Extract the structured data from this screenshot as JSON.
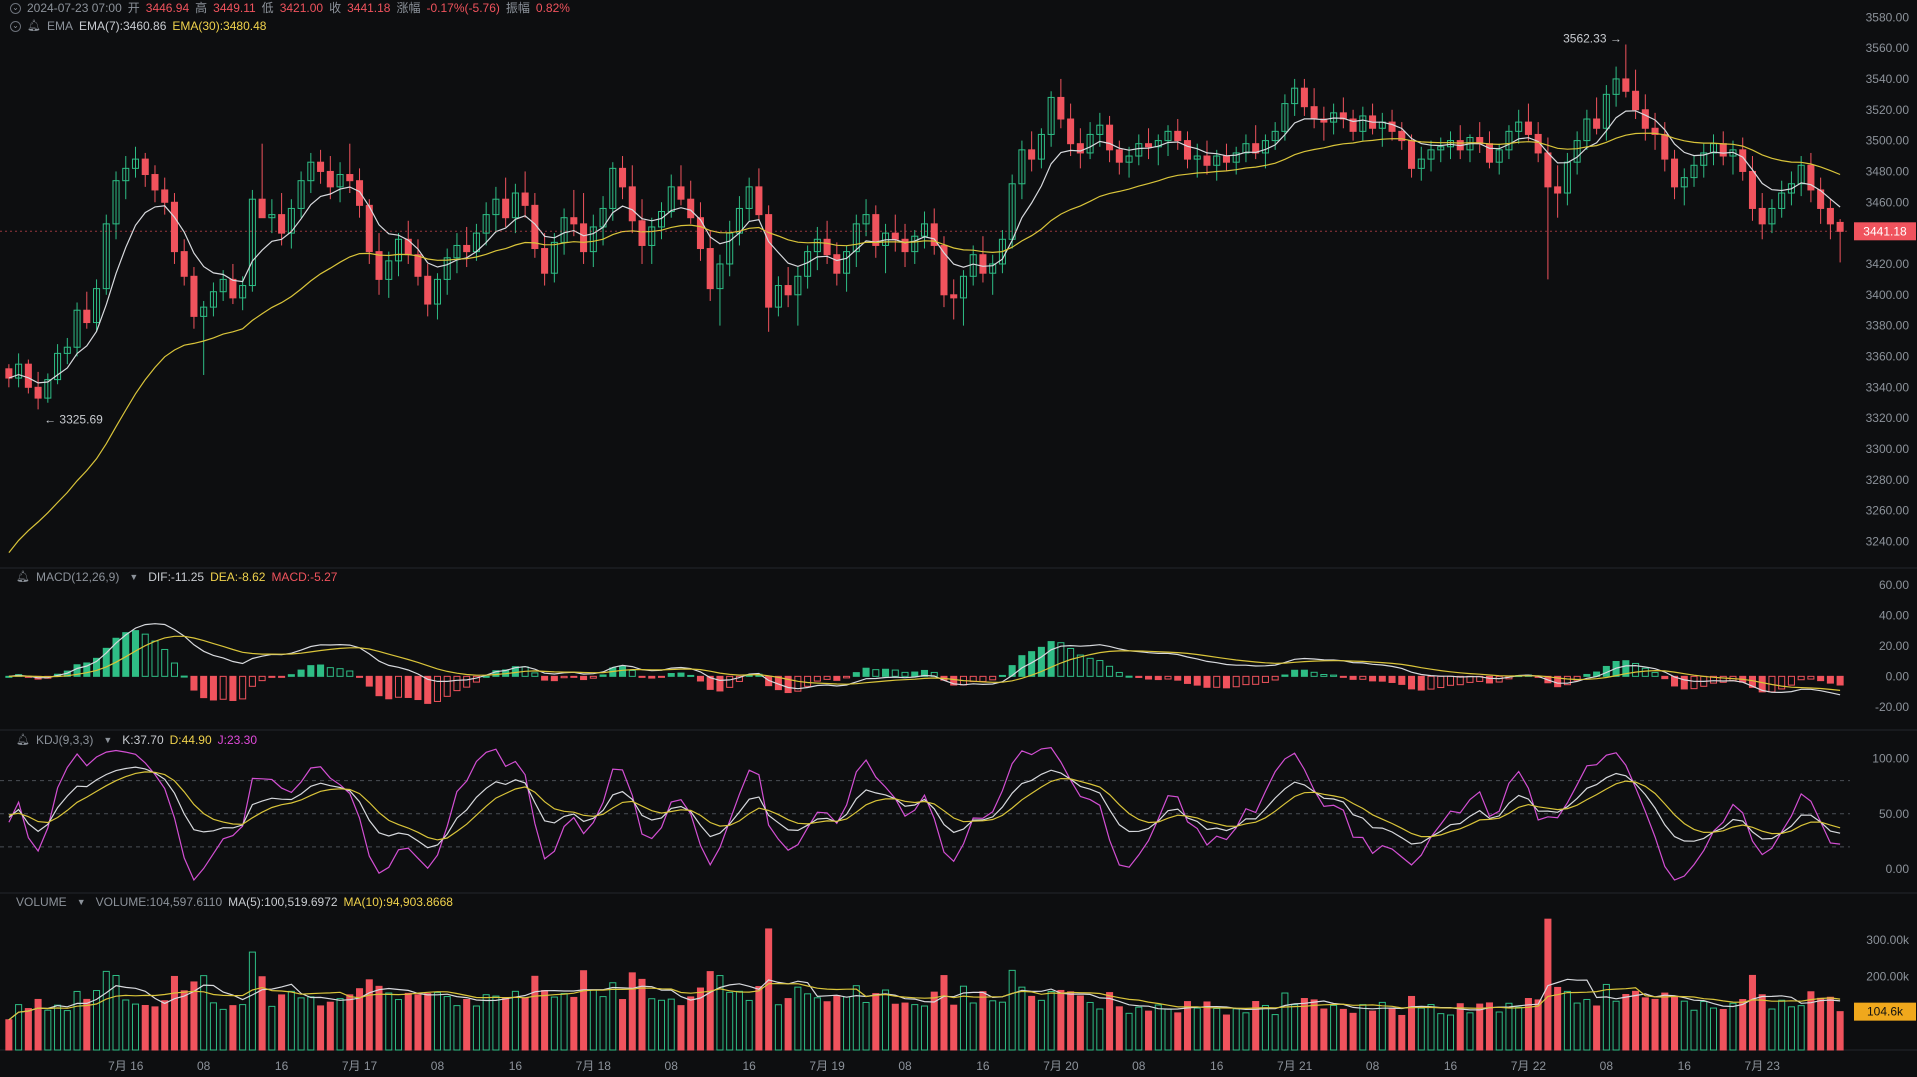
{
  "header": {
    "datetime": "2024-07-23 07:00",
    "open_label": "开",
    "open": "3446.94",
    "high_label": "高",
    "high": "3449.11",
    "low_label": "低",
    "low": "3421.00",
    "close_label": "收",
    "close": "3441.18",
    "change_label": "涨幅",
    "change": "-0.17%(-5.76)",
    "amplitude_label": "振幅",
    "amplitude": "0.82%"
  },
  "ema_legend": {
    "name": "EMA",
    "ema7": "EMA(7):3460.86",
    "ema30": "EMA(30):3480.48"
  },
  "macd_legend": {
    "name": "MACD(12,26,9)",
    "dif": "DIF:-11.25",
    "dea": "DEA:-8.62",
    "macd": "MACD:-5.27"
  },
  "kdj_legend": {
    "name": "KDJ(9,3,3)",
    "k": "K:37.70",
    "d": "D:44.90",
    "j": "J:23.30"
  },
  "vol_legend": {
    "name": "VOLUME",
    "volume": "VOLUME:104,597.6110",
    "ma5": "MA(5):100,519.6972",
    "ma10": "MA(10):94,903.8668"
  },
  "annotations": {
    "high_marker": "3562.33 →",
    "low_marker": "← 3325.69"
  },
  "price_axis": [
    "3580.00",
    "3560.00",
    "3540.00",
    "3520.00",
    "3500.00",
    "3480.00",
    "3460.00",
    "3440.00",
    "3420.00",
    "3400.00",
    "3380.00",
    "3360.00",
    "3340.00",
    "3320.00",
    "3300.00",
    "3280.00",
    "3260.00",
    "3240.00"
  ],
  "macd_axis": [
    "60.00",
    "40.00",
    "20.00",
    "0.00",
    "-20.00"
  ],
  "kdj_axis": [
    "100.00",
    "50.00",
    "0.00"
  ],
  "vol_axis": [
    "300.00k",
    "200.00k"
  ],
  "last_price_tag": "3441.18",
  "last_vol_tag": "104.6k",
  "time_axis": [
    "7月 16",
    "08",
    "16",
    "7月 17",
    "08",
    "16",
    "7月 18",
    "08",
    "16",
    "7月 19",
    "08",
    "16",
    "7月 20",
    "08",
    "16",
    "7月 21",
    "08",
    "16",
    "7月 22",
    "08",
    "16",
    "7月 23"
  ],
  "colors": {
    "up": "#2ebd85",
    "down": "#f0535d",
    "ema7": "#d7d9dd",
    "ema30": "#d9c43a",
    "kdj_k": "#d7d9dd",
    "kdj_d": "#d9c43a",
    "kdj_j": "#d34fd3",
    "bg": "#0d0e10"
  },
  "chart_data": {
    "type": "candlestick",
    "interval": "1h",
    "start": "2024-07-15 12:00",
    "candles": [
      [
        3352,
        3355,
        3340,
        3346
      ],
      [
        3346,
        3362,
        3340,
        3355
      ],
      [
        3355,
        3358,
        3336,
        3340
      ],
      [
        3340,
        3350,
        3325.69,
        3333
      ],
      [
        3333,
        3349,
        3330,
        3345
      ],
      [
        3345,
        3368,
        3342,
        3362
      ],
      [
        3362,
        3372,
        3355,
        3366
      ],
      [
        3366,
        3395,
        3360,
        3390
      ],
      [
        3390,
        3402,
        3378,
        3382
      ],
      [
        3382,
        3410,
        3376,
        3404
      ],
      [
        3404,
        3452,
        3400,
        3446
      ],
      [
        3446,
        3480,
        3436,
        3474
      ],
      [
        3474,
        3490,
        3462,
        3482
      ],
      [
        3482,
        3496,
        3476,
        3488
      ],
      [
        3488,
        3492,
        3470,
        3478
      ],
      [
        3478,
        3484,
        3460,
        3468
      ],
      [
        3468,
        3476,
        3452,
        3460
      ],
      [
        3460,
        3466,
        3420,
        3428
      ],
      [
        3428,
        3436,
        3406,
        3412
      ],
      [
        3412,
        3418,
        3378,
        3386
      ],
      [
        3386,
        3396,
        3348,
        3392
      ],
      [
        3392,
        3408,
        3386,
        3402
      ],
      [
        3402,
        3416,
        3396,
        3410
      ],
      [
        3410,
        3420,
        3394,
        3398
      ],
      [
        3398,
        3412,
        3390,
        3406
      ],
      [
        3406,
        3468,
        3402,
        3462
      ],
      [
        3462,
        3498,
        3456,
        3450
      ],
      [
        3450,
        3462,
        3440,
        3452
      ],
      [
        3452,
        3466,
        3432,
        3440
      ],
      [
        3440,
        3462,
        3430,
        3456
      ],
      [
        3456,
        3480,
        3450,
        3474
      ],
      [
        3474,
        3492,
        3466,
        3486
      ],
      [
        3486,
        3494,
        3472,
        3480
      ],
      [
        3480,
        3490,
        3462,
        3470
      ],
      [
        3470,
        3486,
        3460,
        3478
      ],
      [
        3478,
        3498,
        3466,
        3474
      ],
      [
        3474,
        3482,
        3450,
        3458
      ],
      [
        3458,
        3462,
        3420,
        3428
      ],
      [
        3428,
        3440,
        3400,
        3410
      ],
      [
        3410,
        3428,
        3398,
        3422
      ],
      [
        3422,
        3440,
        3412,
        3436
      ],
      [
        3436,
        3448,
        3420,
        3426
      ],
      [
        3426,
        3436,
        3406,
        3412
      ],
      [
        3412,
        3420,
        3386,
        3394
      ],
      [
        3394,
        3414,
        3384,
        3410
      ],
      [
        3410,
        3430,
        3400,
        3424
      ],
      [
        3424,
        3440,
        3414,
        3432
      ],
      [
        3432,
        3444,
        3418,
        3428
      ],
      [
        3428,
        3446,
        3422,
        3440
      ],
      [
        3440,
        3460,
        3432,
        3452
      ],
      [
        3452,
        3470,
        3440,
        3462
      ],
      [
        3462,
        3476,
        3444,
        3450
      ],
      [
        3450,
        3472,
        3440,
        3466
      ],
      [
        3466,
        3480,
        3450,
        3458
      ],
      [
        3458,
        3466,
        3424,
        3430
      ],
      [
        3430,
        3440,
        3406,
        3414
      ],
      [
        3414,
        3440,
        3408,
        3434
      ],
      [
        3434,
        3456,
        3426,
        3450
      ],
      [
        3450,
        3468,
        3438,
        3446
      ],
      [
        3446,
        3466,
        3420,
        3428
      ],
      [
        3428,
        3452,
        3418,
        3444
      ],
      [
        3444,
        3464,
        3432,
        3456
      ],
      [
        3456,
        3486,
        3448,
        3482
      ],
      [
        3482,
        3490,
        3462,
        3470
      ],
      [
        3470,
        3484,
        3440,
        3448
      ],
      [
        3448,
        3462,
        3420,
        3432
      ],
      [
        3432,
        3450,
        3420,
        3444
      ],
      [
        3444,
        3460,
        3436,
        3454
      ],
      [
        3454,
        3478,
        3450,
        3470
      ],
      [
        3470,
        3484,
        3458,
        3462
      ],
      [
        3462,
        3474,
        3446,
        3450
      ],
      [
        3450,
        3460,
        3422,
        3430
      ],
      [
        3430,
        3442,
        3396,
        3404
      ],
      [
        3404,
        3426,
        3380,
        3420
      ],
      [
        3420,
        3448,
        3412,
        3440
      ],
      [
        3440,
        3464,
        3432,
        3456
      ],
      [
        3456,
        3476,
        3448,
        3470
      ],
      [
        3470,
        3482,
        3448,
        3452
      ],
      [
        3452,
        3458,
        3376,
        3392
      ],
      [
        3392,
        3412,
        3386,
        3406
      ],
      [
        3406,
        3418,
        3392,
        3400
      ],
      [
        3400,
        3418,
        3380,
        3412
      ],
      [
        3412,
        3432,
        3404,
        3428
      ],
      [
        3428,
        3444,
        3416,
        3436
      ],
      [
        3436,
        3448,
        3420,
        3426
      ],
      [
        3426,
        3434,
        3406,
        3414
      ],
      [
        3414,
        3432,
        3402,
        3428
      ],
      [
        3428,
        3452,
        3418,
        3446
      ],
      [
        3446,
        3462,
        3438,
        3452
      ],
      [
        3452,
        3458,
        3424,
        3432
      ],
      [
        3432,
        3446,
        3414,
        3440
      ],
      [
        3440,
        3452,
        3428,
        3436
      ],
      [
        3436,
        3446,
        3418,
        3428
      ],
      [
        3428,
        3442,
        3420,
        3438
      ],
      [
        3438,
        3454,
        3430,
        3446
      ],
      [
        3446,
        3456,
        3426,
        3432
      ],
      [
        3432,
        3438,
        3392,
        3400
      ],
      [
        3400,
        3410,
        3384,
        3398
      ],
      [
        3398,
        3416,
        3380,
        3412
      ],
      [
        3412,
        3432,
        3406,
        3426
      ],
      [
        3426,
        3438,
        3408,
        3414
      ],
      [
        3414,
        3426,
        3400,
        3420
      ],
      [
        3420,
        3442,
        3414,
        3436
      ],
      [
        3436,
        3478,
        3430,
        3472
      ],
      [
        3472,
        3500,
        3462,
        3494
      ],
      [
        3494,
        3506,
        3480,
        3488
      ],
      [
        3488,
        3508,
        3482,
        3504
      ],
      [
        3504,
        3532,
        3496,
        3528
      ],
      [
        3528,
        3540,
        3508,
        3514
      ],
      [
        3514,
        3524,
        3490,
        3498
      ],
      [
        3498,
        3508,
        3482,
        3492
      ],
      [
        3492,
        3512,
        3488,
        3504
      ],
      [
        3504,
        3518,
        3496,
        3510
      ],
      [
        3510,
        3516,
        3486,
        3494
      ],
      [
        3494,
        3500,
        3478,
        3486
      ],
      [
        3486,
        3496,
        3476,
        3490
      ],
      [
        3490,
        3504,
        3484,
        3498
      ],
      [
        3498,
        3508,
        3488,
        3496
      ],
      [
        3496,
        3504,
        3484,
        3500
      ],
      [
        3500,
        3510,
        3490,
        3506
      ],
      [
        3506,
        3514,
        3494,
        3500
      ],
      [
        3500,
        3506,
        3482,
        3488
      ],
      [
        3488,
        3498,
        3476,
        3490
      ],
      [
        3490,
        3500,
        3478,
        3484
      ],
      [
        3484,
        3494,
        3474,
        3490
      ],
      [
        3490,
        3498,
        3480,
        3486
      ],
      [
        3486,
        3496,
        3478,
        3492
      ],
      [
        3492,
        3504,
        3486,
        3498
      ],
      [
        3498,
        3510,
        3488,
        3492
      ],
      [
        3492,
        3504,
        3482,
        3500
      ],
      [
        3500,
        3512,
        3494,
        3506
      ],
      [
        3506,
        3530,
        3500,
        3524
      ],
      [
        3524,
        3540,
        3516,
        3534
      ],
      [
        3534,
        3540,
        3516,
        3522
      ],
      [
        3522,
        3534,
        3508,
        3514
      ],
      [
        3514,
        3522,
        3500,
        3512
      ],
      [
        3512,
        3524,
        3504,
        3518
      ],
      [
        3518,
        3528,
        3508,
        3514
      ],
      [
        3514,
        3520,
        3500,
        3506
      ],
      [
        3506,
        3522,
        3500,
        3516
      ],
      [
        3516,
        3524,
        3504,
        3508
      ],
      [
        3508,
        3518,
        3496,
        3512
      ],
      [
        3512,
        3520,
        3500,
        3506
      ],
      [
        3506,
        3512,
        3494,
        3500
      ],
      [
        3500,
        3504,
        3476,
        3482
      ],
      [
        3482,
        3496,
        3474,
        3488
      ],
      [
        3488,
        3500,
        3480,
        3494
      ],
      [
        3494,
        3502,
        3486,
        3496
      ],
      [
        3496,
        3506,
        3488,
        3500
      ],
      [
        3500,
        3510,
        3488,
        3494
      ],
      [
        3494,
        3504,
        3486,
        3502
      ],
      [
        3502,
        3512,
        3492,
        3498
      ],
      [
        3498,
        3506,
        3482,
        3486
      ],
      [
        3486,
        3498,
        3478,
        3494
      ],
      [
        3494,
        3510,
        3488,
        3506
      ],
      [
        3506,
        3520,
        3498,
        3512
      ],
      [
        3512,
        3524,
        3500,
        3504
      ],
      [
        3504,
        3512,
        3486,
        3492
      ],
      [
        3492,
        3502,
        3410,
        3470
      ],
      [
        3470,
        3484,
        3450,
        3466
      ],
      [
        3466,
        3492,
        3458,
        3486
      ],
      [
        3486,
        3506,
        3478,
        3500
      ],
      [
        3500,
        3520,
        3494,
        3514
      ],
      [
        3514,
        3528,
        3504,
        3508
      ],
      [
        3508,
        3536,
        3500,
        3530
      ],
      [
        3530,
        3548,
        3522,
        3540
      ],
      [
        3540,
        3562.33,
        3528,
        3532
      ],
      [
        3532,
        3546,
        3514,
        3520
      ],
      [
        3520,
        3530,
        3500,
        3508
      ],
      [
        3508,
        3518,
        3494,
        3504
      ],
      [
        3504,
        3512,
        3480,
        3488
      ],
      [
        3488,
        3494,
        3462,
        3470
      ],
      [
        3470,
        3482,
        3458,
        3476
      ],
      [
        3476,
        3490,
        3470,
        3484
      ],
      [
        3484,
        3498,
        3476,
        3492
      ],
      [
        3492,
        3504,
        3484,
        3498
      ],
      [
        3498,
        3506,
        3484,
        3490
      ],
      [
        3490,
        3500,
        3478,
        3494
      ],
      [
        3494,
        3502,
        3474,
        3480
      ],
      [
        3480,
        3490,
        3448,
        3456
      ],
      [
        3456,
        3466,
        3436,
        3446
      ],
      [
        3446,
        3462,
        3440,
        3456
      ],
      [
        3456,
        3474,
        3450,
        3466
      ],
      [
        3466,
        3480,
        3458,
        3472
      ],
      [
        3472,
        3490,
        3464,
        3484
      ],
      [
        3484,
        3492,
        3460,
        3468
      ],
      [
        3468,
        3476,
        3446,
        3456
      ],
      [
        3456,
        3462,
        3436,
        3446
      ],
      [
        3446.94,
        3449.11,
        3421.0,
        3441.18
      ]
    ],
    "ema7": "EMA(7):3460.86",
    "ema30": "EMA(30):3480.48",
    "high_label": "3562.33",
    "low_label": "3325.69",
    "ylim": [
      3228,
      3586
    ]
  }
}
